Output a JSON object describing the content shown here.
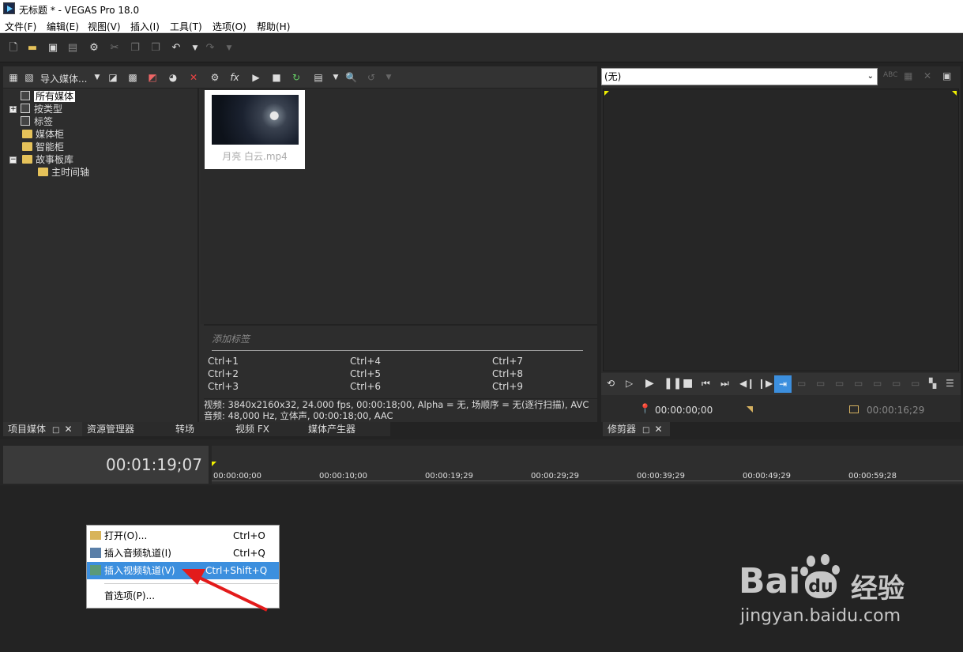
{
  "window": {
    "title": "无标题 * - VEGAS Pro 18.0"
  },
  "menubar": {
    "items": [
      "文件(F)",
      "编辑(E)",
      "视图(V)",
      "插入(I)",
      "工具(T)",
      "选项(O)",
      "帮助(H)"
    ]
  },
  "media_panel": {
    "import_label": "导入媒体...",
    "tree": [
      {
        "label": "所有媒体"
      },
      {
        "label": "按类型"
      },
      {
        "label": "标签"
      },
      {
        "label": "媒体柜"
      },
      {
        "label": "智能柜"
      },
      {
        "label": "故事板库"
      },
      {
        "label": "主时间轴"
      }
    ],
    "clip": {
      "name": "月亮 白云.mp4"
    },
    "tag_placeholder": "添加标签",
    "shortcuts": [
      "Ctrl+1",
      "Ctrl+4",
      "Ctrl+7",
      "Ctrl+2",
      "Ctrl+5",
      "Ctrl+8",
      "Ctrl+3",
      "Ctrl+6",
      "Ctrl+9"
    ],
    "info_video": "视频: 3840x2160x32, 24.000 fps, 00:00:18;00, Alpha = 无, 场顺序 = 无(逐行扫描), AVC",
    "info_audio": "音频: 48,000 Hz, 立体声, 00:00:18;00, AAC",
    "tabs": [
      "项目媒体",
      "资源管理器",
      "转场",
      "视频 FX",
      "媒体产生器"
    ]
  },
  "trimmer": {
    "dropdown_value": "(无)",
    "time_in": "00:00:00;00",
    "time_out": "00:00:16;29",
    "tab": "修剪器"
  },
  "timeline": {
    "current_time": "00:01:19;07",
    "ruler": [
      "00:00:00;00",
      "00:00:10;00",
      "00:00:19;29",
      "00:00:29;29",
      "00:00:39;29",
      "00:00:49;29",
      "00:00:59;28"
    ]
  },
  "context_menu": {
    "items": [
      {
        "label": "打开(O)...",
        "shortcut": "Ctrl+O"
      },
      {
        "label": "插入音频轨道(I)",
        "shortcut": "Ctrl+Q"
      },
      {
        "label": "插入视频轨道(V)",
        "shortcut": "Ctrl+Shift+Q"
      },
      {
        "label": "首选项(P)...",
        "shortcut": ""
      }
    ]
  },
  "watermark": {
    "brand": "Bai",
    "brand2": "du",
    "cn": "经验",
    "url": "jingyan.baidu.com"
  },
  "colors": {
    "accent": "#3c8fde",
    "panel": "#2d2d2d",
    "folder": "#e5c25a"
  }
}
